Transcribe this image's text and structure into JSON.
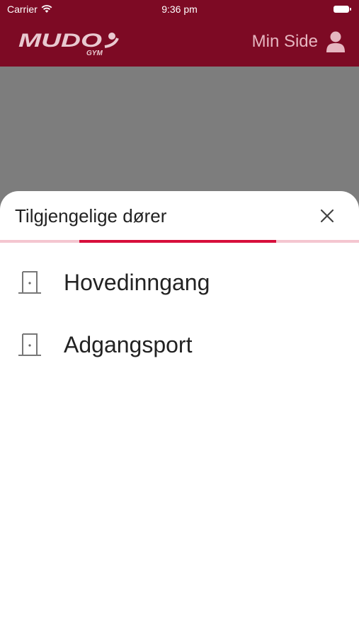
{
  "status_bar": {
    "carrier": "Carrier",
    "time": "9:36 pm"
  },
  "header": {
    "logo_text": "MUDO GYM",
    "min_side_label": "Min Side"
  },
  "colors": {
    "brand": "#7d0a24",
    "accent": "#d70f3c",
    "accent_light": "#f4c6d0"
  },
  "sheet": {
    "title": "Tilgjengelige dører",
    "loading_progress": {
      "start": 0.22,
      "end": 0.77
    },
    "doors": [
      {
        "label": "Hovedinngang",
        "icon": "door-icon"
      },
      {
        "label": "Adgangsport",
        "icon": "door-icon"
      }
    ]
  }
}
